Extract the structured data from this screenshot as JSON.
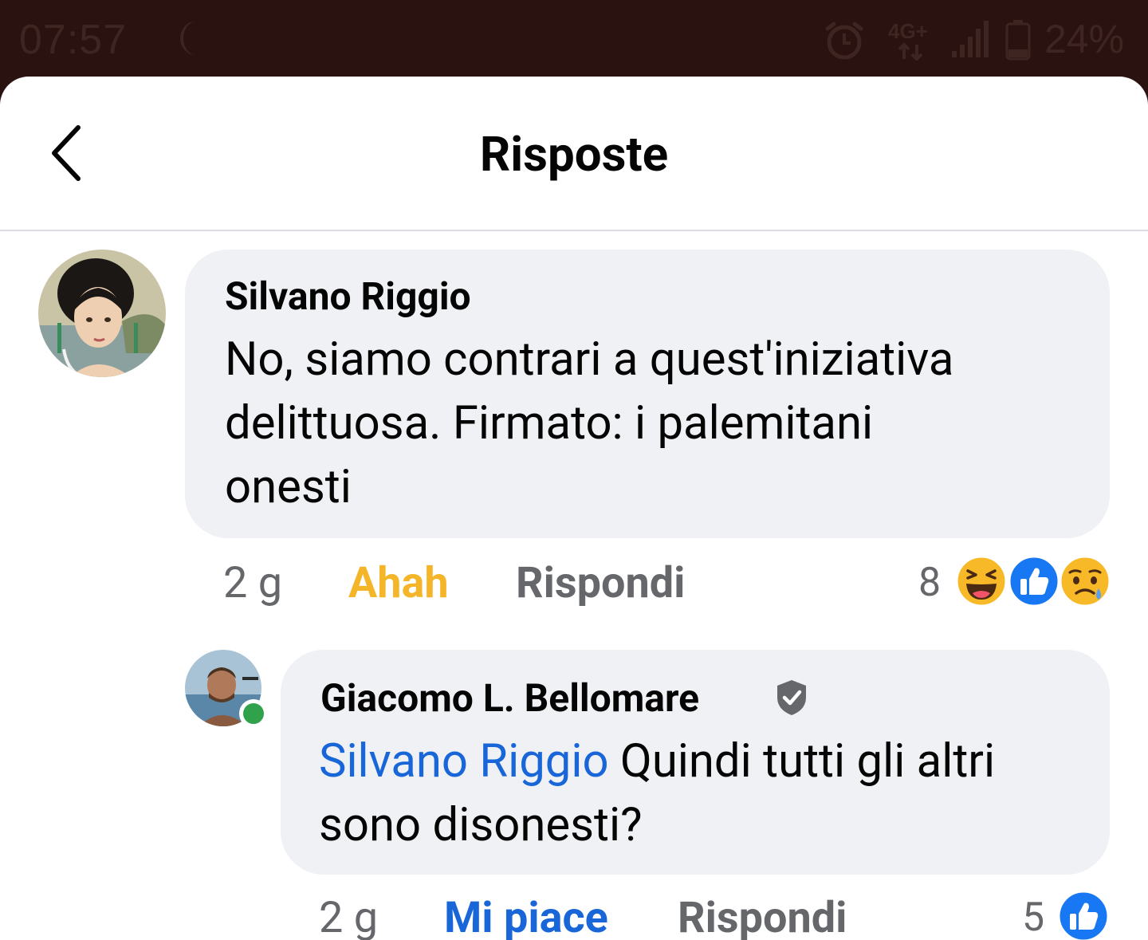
{
  "status_bar": {
    "time": "07:57",
    "network": "4G+",
    "battery": "24%",
    "icons": [
      "moon-icon",
      "alarm-icon",
      "network-icon",
      "signal-icon",
      "battery-icon"
    ]
  },
  "header": {
    "title": "Risposte",
    "back_icon": "chevron-left-icon"
  },
  "comments": [
    {
      "author": "Silvano Riggio",
      "lines": [
        "No, siamo contrari a quest'iniziativa",
        "delittuosa. Firmato: i palemitani",
        "onesti"
      ],
      "time": "2 g",
      "reaction_label": "Ahah",
      "reply_label": "Rispondi",
      "reaction_count": "8",
      "reaction_icons": [
        "haha-icon",
        "like-icon",
        "sad-icon"
      ]
    },
    {
      "author": "Giacomo L. Bellomare",
      "verified_icon": "verified-shield-icon",
      "online": true,
      "mention": "Silvano Riggio",
      "line1_rest": " Quindi tutti gli altri",
      "line2": "sono disonesti?",
      "time": "2 g",
      "reaction_label": "Mi piace",
      "reply_label": "Rispondi",
      "reaction_count": "5",
      "reaction_icons": [
        "like-icon"
      ]
    }
  ],
  "colors": {
    "status_bar_bg": "#2a1210",
    "bubble_bg": "#f0f1f4",
    "haha_label": "#f4b528",
    "like_label": "#1866d8",
    "mention": "#1866d8",
    "meta_gray": "#65676b",
    "online": "#31a24c"
  }
}
